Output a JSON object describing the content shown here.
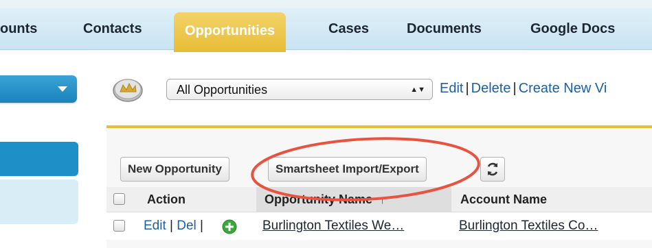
{
  "tabs": [
    {
      "label": "ounts",
      "active": false
    },
    {
      "label": "Contacts",
      "active": false
    },
    {
      "label": "Opportunities",
      "active": true
    },
    {
      "label": "Cases",
      "active": false
    },
    {
      "label": "Documents",
      "active": false
    },
    {
      "label": "Google Docs",
      "active": false
    }
  ],
  "view": {
    "selected": "All Opportunities",
    "links": [
      "Edit",
      "Delete",
      "Create New Vi"
    ],
    "separator": "|"
  },
  "toolbar": {
    "new_label": "New Opportunity",
    "smartsheet_label": "Smartsheet Import/Export"
  },
  "table": {
    "columns": [
      "Action",
      "Opportunity Name",
      "Account Name"
    ],
    "sort_indicator": "↑",
    "rows": [
      {
        "actions": {
          "edit": "Edit",
          "del": "Del",
          "separator": "|"
        },
        "opportunity": "Burlington Textiles We…",
        "account": "Burlington Textiles Co…"
      }
    ]
  },
  "colors": {
    "tab_active": "#e8bd34",
    "tabbar": "#cde6f3",
    "link": "#1a5fa8",
    "sidebar_accent": "#1f8fc8",
    "highlight_ring": "#e8523f"
  }
}
